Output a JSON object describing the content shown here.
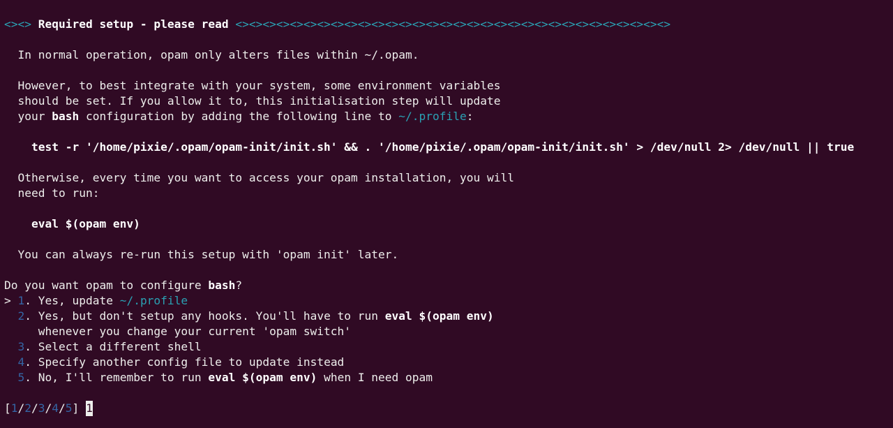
{
  "window": {
    "type": "terminal"
  },
  "header": {
    "prefix": "<><>",
    "title": "Required setup - please read",
    "suffix": "<><><><><><><><><><><><><><><><><><><><><><><><><><><><><><><><>"
  },
  "body": {
    "p1": "In normal operation, opam only alters files within ~/.opam.",
    "p2_l1": "However, to best integrate with your system, some environment variables",
    "p2_l2": "should be set. If you allow it to, this initialisation step will update",
    "p2_l3_a": "your ",
    "p2_l3_shell": "bash",
    "p2_l3_b": " configuration by adding the following line to ",
    "p2_l3_file": "~/.profile",
    "p2_l3_c": ":",
    "init_cmd": "test -r '/home/pixie/.opam/opam-init/init.sh' && . '/home/pixie/.opam/opam-init/init.sh' > /dev/null 2> /dev/null || true",
    "p3_l1": "Otherwise, every time you want to access your opam installation, you will",
    "p3_l2": "need to run:",
    "eval_cmd": "eval $(opam env)",
    "p4": "You can always re-run this setup with 'opam init' later."
  },
  "question": {
    "prefix": "Do you want opam to configure ",
    "shell": "bash",
    "suffix": "?"
  },
  "options": [
    {
      "marker": "> ",
      "num": "1",
      "text": "Yes, update ",
      "file": "~/.profile"
    },
    {
      "marker": "  ",
      "num": "2",
      "text": "Yes, but don't setup any hooks. You'll have to run ",
      "cmd": "eval $(opam env)",
      "cont": "whenever you change your current 'opam switch'"
    },
    {
      "marker": "  ",
      "num": "3",
      "text": "Select a different shell"
    },
    {
      "marker": "  ",
      "num": "4",
      "text": "Specify another config file to update instead"
    },
    {
      "marker": "  ",
      "num": "5",
      "text": "No, I'll remember to run ",
      "cmd": "eval $(opam env)",
      "text2": " when I need opam"
    }
  ],
  "prompt": {
    "choices": [
      "1",
      "2",
      "3",
      "4",
      "5"
    ],
    "input": "1"
  },
  "colors": {
    "background": "#300a24",
    "foreground": "#eeeeec",
    "accent_cyan": "#2aa1b3",
    "accent_blue": "#3465a4"
  }
}
